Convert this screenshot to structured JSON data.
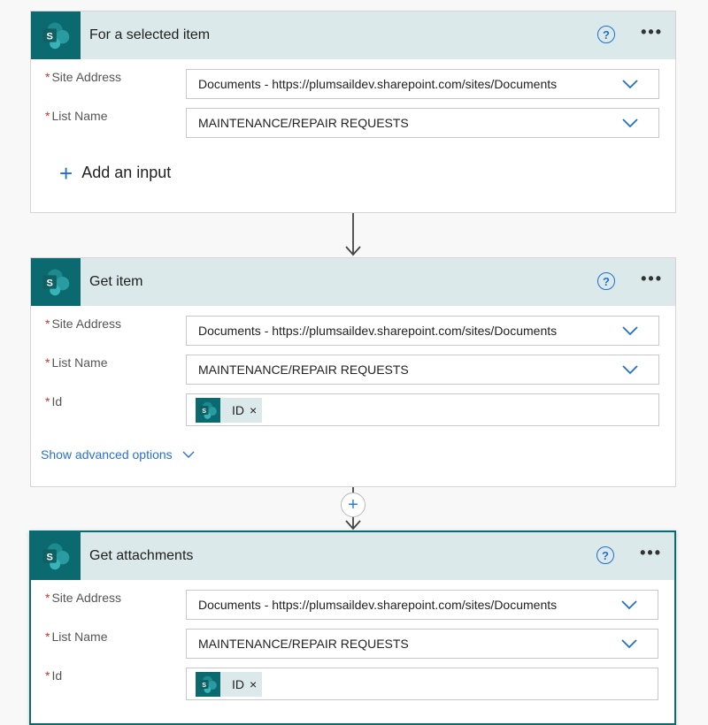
{
  "colors": {
    "accent": "#0b6a6f",
    "header_bg": "#dce9ea",
    "link": "#2b6fd0",
    "required": "#c0392b"
  },
  "cards": [
    {
      "title": "For a selected item",
      "icon": "sharepoint-icon",
      "help": "?",
      "more": "•••",
      "fields": [
        {
          "label": "Site Address",
          "required": "*",
          "value": "Documents - https://plumsaildev.sharepoint.com/sites/Documents"
        },
        {
          "label": "List Name",
          "required": "*",
          "value": "MAINTENANCE/REPAIR REQUESTS"
        }
      ],
      "add_input_label": "Add an input"
    },
    {
      "title": "Get item",
      "icon": "sharepoint-icon",
      "help": "?",
      "more": "•••",
      "fields": [
        {
          "label": "Site Address",
          "required": "*",
          "value": "Documents - https://plumsaildev.sharepoint.com/sites/Documents"
        },
        {
          "label": "List Name",
          "required": "*",
          "value": "MAINTENANCE/REPAIR REQUESTS"
        },
        {
          "label": "Id",
          "required": "*",
          "token": "ID",
          "token_remove": "×"
        }
      ],
      "advanced_label": "Show advanced options"
    },
    {
      "title": "Get attachments",
      "icon": "sharepoint-icon",
      "help": "?",
      "more": "•••",
      "selected": true,
      "fields": [
        {
          "label": "Site Address",
          "required": "*",
          "value": "Documents - https://plumsaildev.sharepoint.com/sites/Documents"
        },
        {
          "label": "List Name",
          "required": "*",
          "value": "MAINTENANCE/REPAIR REQUESTS"
        },
        {
          "label": "Id",
          "required": "*",
          "token": "ID",
          "token_remove": "×"
        }
      ]
    }
  ],
  "insert_step": "+"
}
